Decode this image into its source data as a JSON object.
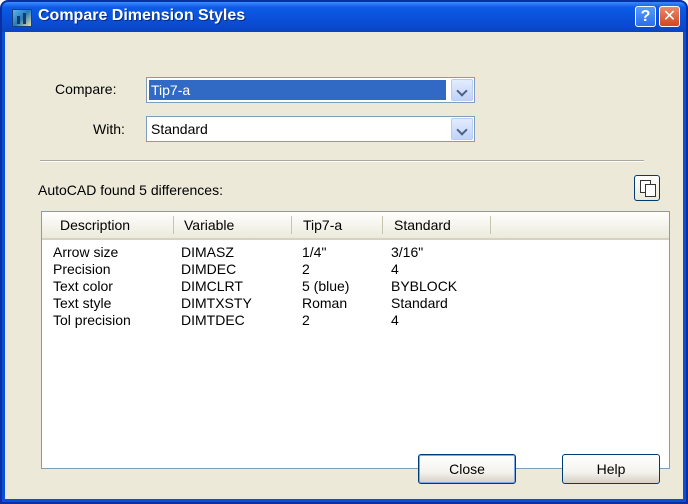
{
  "window": {
    "title": "Compare Dimension Styles",
    "help_glyph": "?",
    "close_glyph": "✕"
  },
  "compare": {
    "label": "Compare:",
    "value": "Tip7-a"
  },
  "with": {
    "label": "With:",
    "value": "Standard"
  },
  "summary": "AutoCAD found 5 differences:",
  "table": {
    "headers": [
      "Description",
      "Variable",
      "Tip7-a",
      "Standard"
    ],
    "rows": [
      [
        "Arrow size",
        "DIMASZ",
        "1/4\"",
        "3/16\""
      ],
      [
        "Precision",
        "DIMDEC",
        "2",
        "4"
      ],
      [
        "Text color",
        "DIMCLRT",
        "5 (blue)",
        "BYBLOCK"
      ],
      [
        "Text style",
        "DIMTXSTY",
        "Roman",
        "Standard"
      ],
      [
        "Tol precision",
        "DIMTDEC",
        "2",
        "4"
      ]
    ]
  },
  "buttons": {
    "close": "Close",
    "help": "Help"
  },
  "icons": {
    "app": "dimension-style-icon",
    "copy": "copy-to-clipboard-icon"
  },
  "colors": {
    "titlebar": "#0a4fd8",
    "selection": "#316ac5",
    "dialog_bg": "#ece9d8"
  }
}
